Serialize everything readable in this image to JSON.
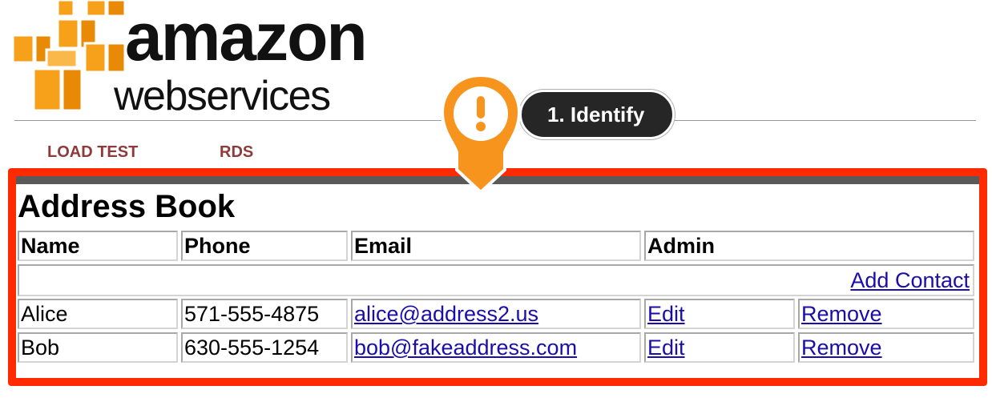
{
  "logo": {
    "line1": "amazon",
    "line2": "webservices",
    "box_color": "#f7a11a",
    "box_shade": "#e88a06"
  },
  "nav": {
    "items": [
      "LOAD TEST",
      "RDS"
    ],
    "color": "#8e3a3a"
  },
  "annotation": {
    "icon": "exclamation-icon",
    "label": "1. Identify",
    "badge_color": "#f7941e",
    "label_bg": "#262626"
  },
  "highlight_color": "#ff2a00",
  "address_book": {
    "title": "Address Book",
    "columns": [
      "Name",
      "Phone",
      "Email",
      "Admin"
    ],
    "add_contact_label": "Add Contact",
    "rows": [
      {
        "name": "Alice",
        "phone": "571-555-4875",
        "email": "alice@address2.us",
        "edit": "Edit",
        "remove": "Remove"
      },
      {
        "name": "Bob",
        "phone": "630-555-1254",
        "email": "bob@fakeaddress.com",
        "edit": "Edit",
        "remove": "Remove"
      }
    ]
  }
}
